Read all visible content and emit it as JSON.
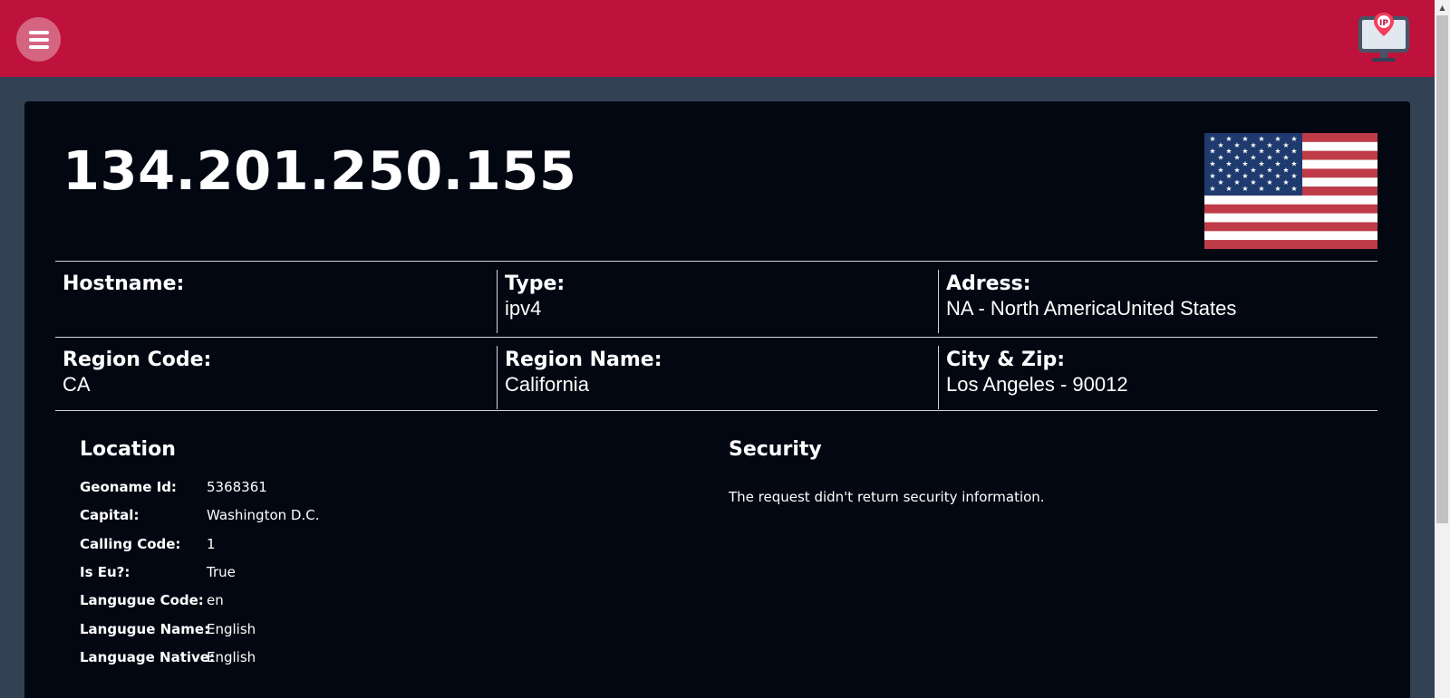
{
  "header": {
    "menu_icon": "hamburger-menu-icon",
    "logo_icon": "ip-monitor-logo-icon",
    "logo_text": "IP",
    "background": "#be123c"
  },
  "ip": {
    "address": "134.201.250.155",
    "flag_icon": "us-flag-icon"
  },
  "info": {
    "hostname_label": "Hostname:",
    "hostname_value": "",
    "type_label": "Type:",
    "type_value": "ipv4",
    "address_label": "Adress:",
    "address_value": "NA - North AmericaUnited States",
    "region_code_label": "Region Code:",
    "region_code_value": "CA",
    "region_name_label": "Region Name:",
    "region_name_value": "California",
    "city_zip_label": "City & Zip:",
    "city_zip_value": "Los Angeles - 90012"
  },
  "location": {
    "title": "Location",
    "rows": [
      {
        "key": "Geoname Id:",
        "value": "5368361"
      },
      {
        "key": "Capital:",
        "value": "Washington D.C."
      },
      {
        "key": "Calling Code:",
        "value": "1"
      },
      {
        "key": "Is Eu?:",
        "value": "True"
      },
      {
        "key": "Langugue Code:",
        "value": "en"
      },
      {
        "key": "Langugue Name:",
        "value": "English"
      },
      {
        "key": "Language Native:",
        "value": "English"
      }
    ]
  },
  "security": {
    "title": "Security",
    "message": "The request didn't return security information."
  },
  "colors": {
    "page_bg": "#334155",
    "card_bg": "#030712",
    "accent": "#be123c"
  }
}
